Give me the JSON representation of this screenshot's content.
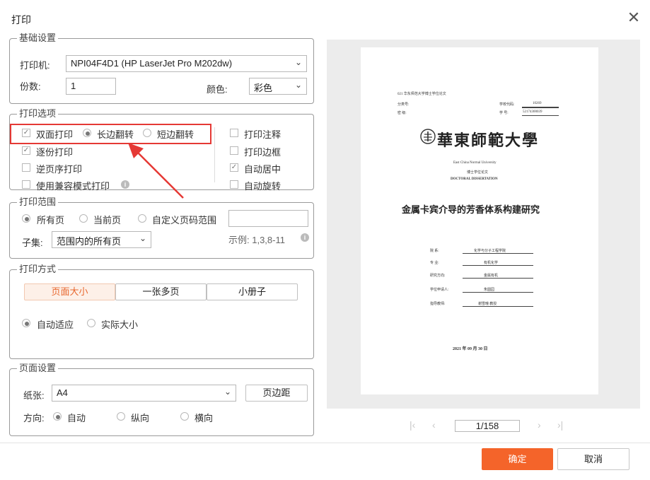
{
  "dialog": {
    "title": "打印"
  },
  "basic": {
    "legend": "基础设置",
    "printer_label": "打印机:",
    "printer_value": "NPI04F4D1 (HP LaserJet Pro M202dw)",
    "copies_label": "份数:",
    "copies_value": "1",
    "color_label": "颜色:",
    "color_value": "彩色"
  },
  "options": {
    "legend": "打印选项",
    "duplex": "双面打印",
    "long_edge": "长边翻转",
    "short_edge": "短边翻转",
    "collate": "逐份打印",
    "reverse": "逆页序打印",
    "compat": "使用兼容模式打印",
    "comments": "打印注释",
    "border": "打印边框",
    "center": "自动居中",
    "rotate": "自动旋转"
  },
  "range": {
    "legend": "打印范围",
    "all": "所有页",
    "current": "当前页",
    "custom": "自定义页码范围",
    "custom_value": "",
    "subset_label": "子集:",
    "subset_value": "范围内的所有页",
    "example": "示例: 1,3,8-11"
  },
  "mode": {
    "legend": "打印方式",
    "tab_page_size": "页面大小",
    "tab_multi": "一张多页",
    "tab_booklet": "小册子",
    "fit": "自动适应",
    "actual": "实际大小"
  },
  "page_setup": {
    "legend": "页面设置",
    "paper_label": "纸张:",
    "paper_value": "A4",
    "margins_button": "页边距",
    "orientation_label": "方向:",
    "auto": "自动",
    "portrait": "纵向",
    "landscape": "横向"
  },
  "preview": {
    "header_line1": "021 华东师范大学博士学位论文",
    "class_label": "分类号:",
    "school_code_label": "学校代码:",
    "school_code": "10269",
    "secret_label": "密  级:",
    "student_label": "学  号:",
    "student_no": "52174300039",
    "university": "華東師範大學",
    "university_en": "East China Normal University",
    "degree_cn": "博士学位论文",
    "degree_en": "DOCTORAL DISSERTATION",
    "thesis_title": "金属卡宾介导的芳香体系构建研究",
    "dept_label": "院  系:",
    "dept": "化学与分子工程学院",
    "major_label": "专  业:",
    "major": "有机化学",
    "direction_label": "研究方向:",
    "direction": "金属有机",
    "applicant_label": "学位申请人:",
    "applicant": "朱圆园",
    "advisor_label": "指导教师:",
    "advisor": "谢雪曈  教授",
    "date": "2021 年 09 月 30 日",
    "page_indicator": "1/158"
  },
  "footer": {
    "ok": "确定",
    "cancel": "取消"
  }
}
